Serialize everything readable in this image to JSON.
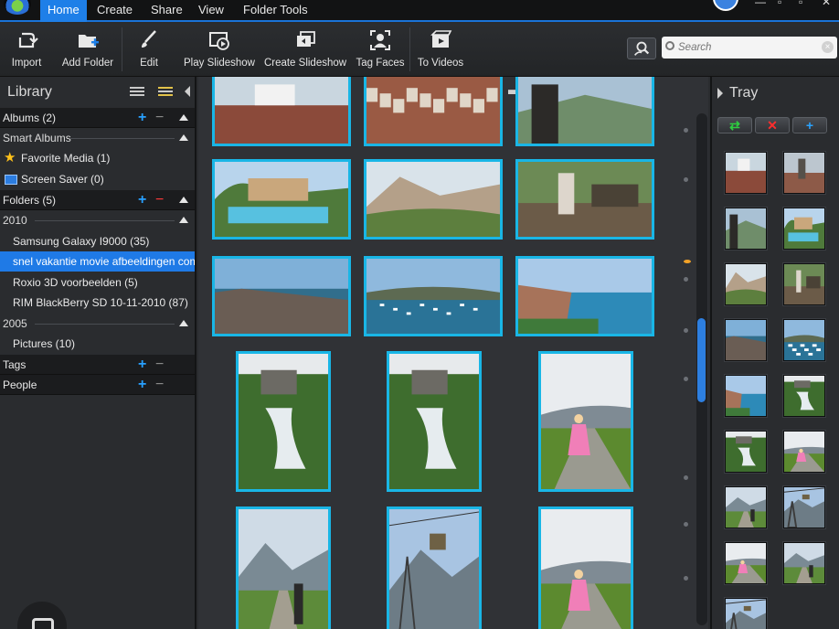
{
  "menubar": {
    "tabs": [
      {
        "label": "Home",
        "active": true
      },
      {
        "label": "Create",
        "active": false
      },
      {
        "label": "Share",
        "active": false
      },
      {
        "label": "View",
        "active": false
      },
      {
        "label": "Folder Tools",
        "active": false
      }
    ],
    "window_controls": [
      "minimize",
      "maximize",
      "close"
    ]
  },
  "toolbar": {
    "buttons": [
      {
        "label": "Import",
        "icon": "import-icon"
      },
      {
        "label": "Add Folder",
        "icon": "add-folder-icon"
      },
      {
        "label": "Edit",
        "icon": "edit-brush-icon"
      },
      {
        "label": "Play Slideshow",
        "icon": "play-slideshow-icon"
      },
      {
        "label": "Create Slideshow",
        "icon": "create-slideshow-icon"
      },
      {
        "label": "Tag Faces",
        "icon": "tag-faces-icon"
      },
      {
        "label": "To Videos",
        "icon": "to-videos-icon"
      }
    ],
    "search": {
      "placeholder": "Search"
    }
  },
  "library": {
    "title": "Library",
    "albums": "Albums (2)",
    "smart_albums": "Smart Albums",
    "favorite_media": "Favorite Media (1)",
    "screen_saver": "Screen Saver (0)",
    "folders": "Folders (5)",
    "year_2010": "2010",
    "folder_items_2010": [
      {
        "label": "Samsung Galaxy I9000 (35)",
        "selected": false
      },
      {
        "label": "snel vakantie movie afbeeldingen compi",
        "selected": true
      },
      {
        "label": "Roxio 3D voorbeelden (5)",
        "selected": false
      },
      {
        "label": "RIM BlackBerry SD 10-11-2010 (87)",
        "selected": false
      }
    ],
    "year_2005": "2005",
    "folder_items_2005": [
      {
        "label": "Pictures (10)",
        "selected": false
      }
    ],
    "tags": "Tags",
    "people": "People"
  },
  "gallery": {
    "toolbar_icons": [
      "star-rating-icon",
      "rotate-left-icon",
      "rotate-right-icon",
      "slideshow-panel-icon",
      "folder-icon"
    ],
    "photos": [
      {
        "scene": "village"
      },
      {
        "scene": "town-rooftops"
      },
      {
        "scene": "person-mountain"
      },
      {
        "scene": "pool-villa"
      },
      {
        "scene": "rocky-hill"
      },
      {
        "scene": "sign-garden"
      },
      {
        "scene": "harbor-wall"
      },
      {
        "scene": "boats-bay"
      },
      {
        "scene": "beach-cliff"
      },
      {
        "scene": "waterfall-house"
      },
      {
        "scene": "waterfall-house"
      },
      {
        "scene": "child-pink-coat"
      },
      {
        "scene": "hikers-mountain"
      },
      {
        "scene": "cable-car"
      },
      {
        "scene": "child-pink-coat"
      }
    ]
  },
  "tray": {
    "title": "Tray",
    "buttons": [
      {
        "icon": "recycle-icon",
        "color": "#2ecc40"
      },
      {
        "icon": "remove-icon",
        "color": "#ff2d2d"
      },
      {
        "icon": "add-icon",
        "color": "#29a3ff"
      }
    ],
    "thumbs": [
      "village",
      "tower",
      "person-mountain",
      "pool-villa",
      "rocky-hill",
      "sign-garden",
      "harbor-wall",
      "boats-bay",
      "beach-cliff",
      "waterfall-house",
      "waterfall-house",
      "child-pink-coat",
      "hikers-mountain",
      "cable-car",
      "child-pink-coat",
      "hikers-mountain",
      "cable-car"
    ]
  },
  "colors": {
    "accent": "#1e7fe8",
    "thumb_border": "#19b6e6",
    "plus": "#28a0ff",
    "danger": "#ff3a3a"
  }
}
